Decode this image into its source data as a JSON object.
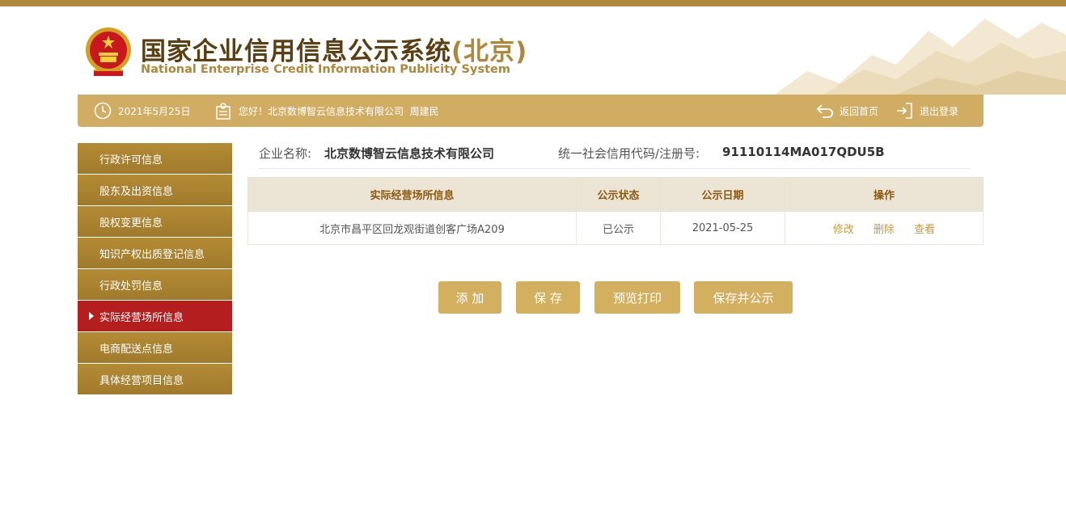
{
  "header": {
    "title_cn": "国家企业信用信息公示系统",
    "title_region": "(北京)",
    "title_en": "National Enterprise Credit Information Publicity System",
    "emblem_icon": "national-emblem-icon",
    "accent_color": "#b0873a"
  },
  "infobar": {
    "date": "2021年5月25日",
    "greeting": "您好！北京数博智云信息技术有限公司  周建民",
    "home_label": "返回首页",
    "logout_label": "退出登录"
  },
  "sidebar": {
    "items": [
      {
        "label": "行政许可信息",
        "active": false
      },
      {
        "label": "股东及出资信息",
        "active": false
      },
      {
        "label": "股权变更信息",
        "active": false
      },
      {
        "label": "知识产权出质登记信息",
        "active": false
      },
      {
        "label": "行政处罚信息",
        "active": false
      },
      {
        "label": "实际经营场所信息",
        "active": true
      },
      {
        "label": "电商配送点信息",
        "active": false
      },
      {
        "label": "具体经营项目信息",
        "active": false
      }
    ]
  },
  "company": {
    "name_label": "企业名称:",
    "name_value": "北京数博智云信息技术有限公司",
    "code_label": "统一社会信用代码/注册号:",
    "code_value": "91110114MA017QDU5B"
  },
  "table": {
    "headers": [
      "实际经营场所信息",
      "公示状态",
      "公示日期",
      "操作"
    ],
    "rows": [
      {
        "address": "北京市昌平区回龙观街道创客广场A209",
        "status": "已公示",
        "date": "2021-05-25",
        "actions": [
          "修改",
          "删除",
          "查看"
        ]
      }
    ]
  },
  "buttons": {
    "add": "添 加",
    "save": "保 存",
    "preview_print": "预览打印",
    "save_publish": "保存并公示"
  },
  "colors": {
    "bar": "#d0ad62",
    "sidebar": "#a8822f",
    "active": "#b51e1e",
    "button": "#d3b060"
  }
}
